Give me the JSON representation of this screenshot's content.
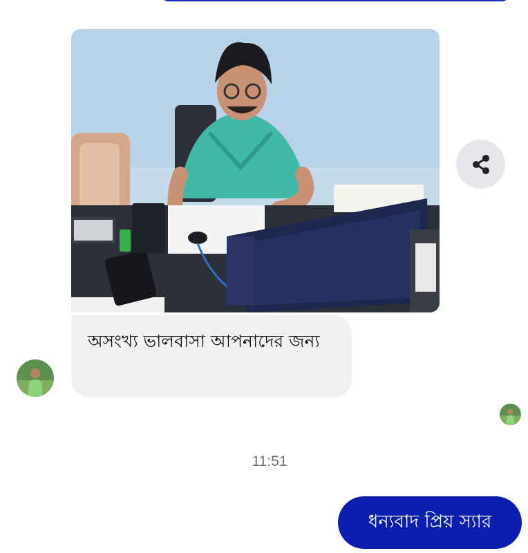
{
  "conversation": {
    "incoming_photo": {
      "alt": "photo-message",
      "accent": "#3fb8a6"
    },
    "incoming_text": "অসংখ্য ভালবাসা আপনাদের জন্য",
    "timestamp": "11:51",
    "outgoing_text": "ধন্যবাদ প্রিয় স্যার"
  },
  "actions": {
    "share_icon": "share-icon"
  },
  "colors": {
    "outgoing_bubble": "#0a1fb0",
    "incoming_bubble": "#f0f1f3",
    "share_button_bg": "#e6e7ea",
    "timestamp_text": "#6b6f76"
  }
}
